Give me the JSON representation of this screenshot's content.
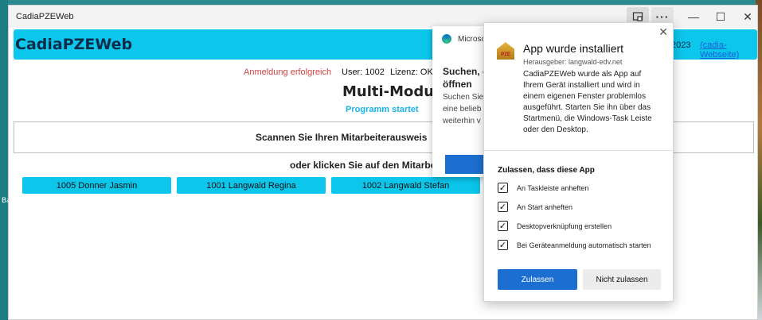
{
  "window": {
    "title": "CadiaPZEWeb",
    "controls": {
      "more": "···",
      "minimize": "—",
      "maximize": "☐",
      "close": "✕"
    }
  },
  "desktop": {
    "left_text": "Ba"
  },
  "header": {
    "brand": "CadiaPZEWeb",
    "year": "2023",
    "site_link": "(cadia-Webseite)"
  },
  "status": {
    "login": "Anmeldung erfolgreich",
    "user": "User: 1002",
    "license": "Lizenz: OK",
    "mode": "Multi-Modus",
    "program": "Programm startet"
  },
  "scan": {
    "prompt": "Scannen Sie Ihren Mitarbeiterausweis",
    "or_click": "oder klicken Sie auf den Mitarbei"
  },
  "employees": [
    "1005 Donner Jasmin",
    "1001 Langwald Regina",
    "1002 Langwald Stefan"
  ],
  "edge_dialog": {
    "brand": "Microso",
    "heading_line1": "Suchen, c",
    "heading_line2": "öffnen",
    "body_line1": "Suchen Sie",
    "body_line2": "eine belieb",
    "body_line3": "weiterhin v"
  },
  "install_popup": {
    "close": "✕",
    "app_icon_label": "PZE",
    "title": "App wurde installiert",
    "publisher": "Herausgeber: langwald-edv.net",
    "description": "CadiaPZEWeb wurde als App auf Ihrem Gerät installiert und wird in einem eigenen Fenster problemlos ausgeführt. Starten Sie ihn über das Startmenü, die Windows-Task Leiste oder den Desktop.",
    "allow_heading": "Zulassen, dass diese App",
    "options": [
      {
        "label": "An Taskleiste anheften",
        "checked": true
      },
      {
        "label": "An Start anheften",
        "checked": true
      },
      {
        "label": "Desktopverknüpfung erstellen",
        "checked": true
      },
      {
        "label": "Bei Geräteanmeldung automatisch starten",
        "checked": true
      }
    ],
    "allow_button": "Zulassen",
    "deny_button": "Nicht zulassen"
  },
  "colors": {
    "accent": "#0cc6ec",
    "primary_button": "#1c6fd0",
    "error_text": "#d0453f",
    "info_text": "#1ab3e8"
  }
}
